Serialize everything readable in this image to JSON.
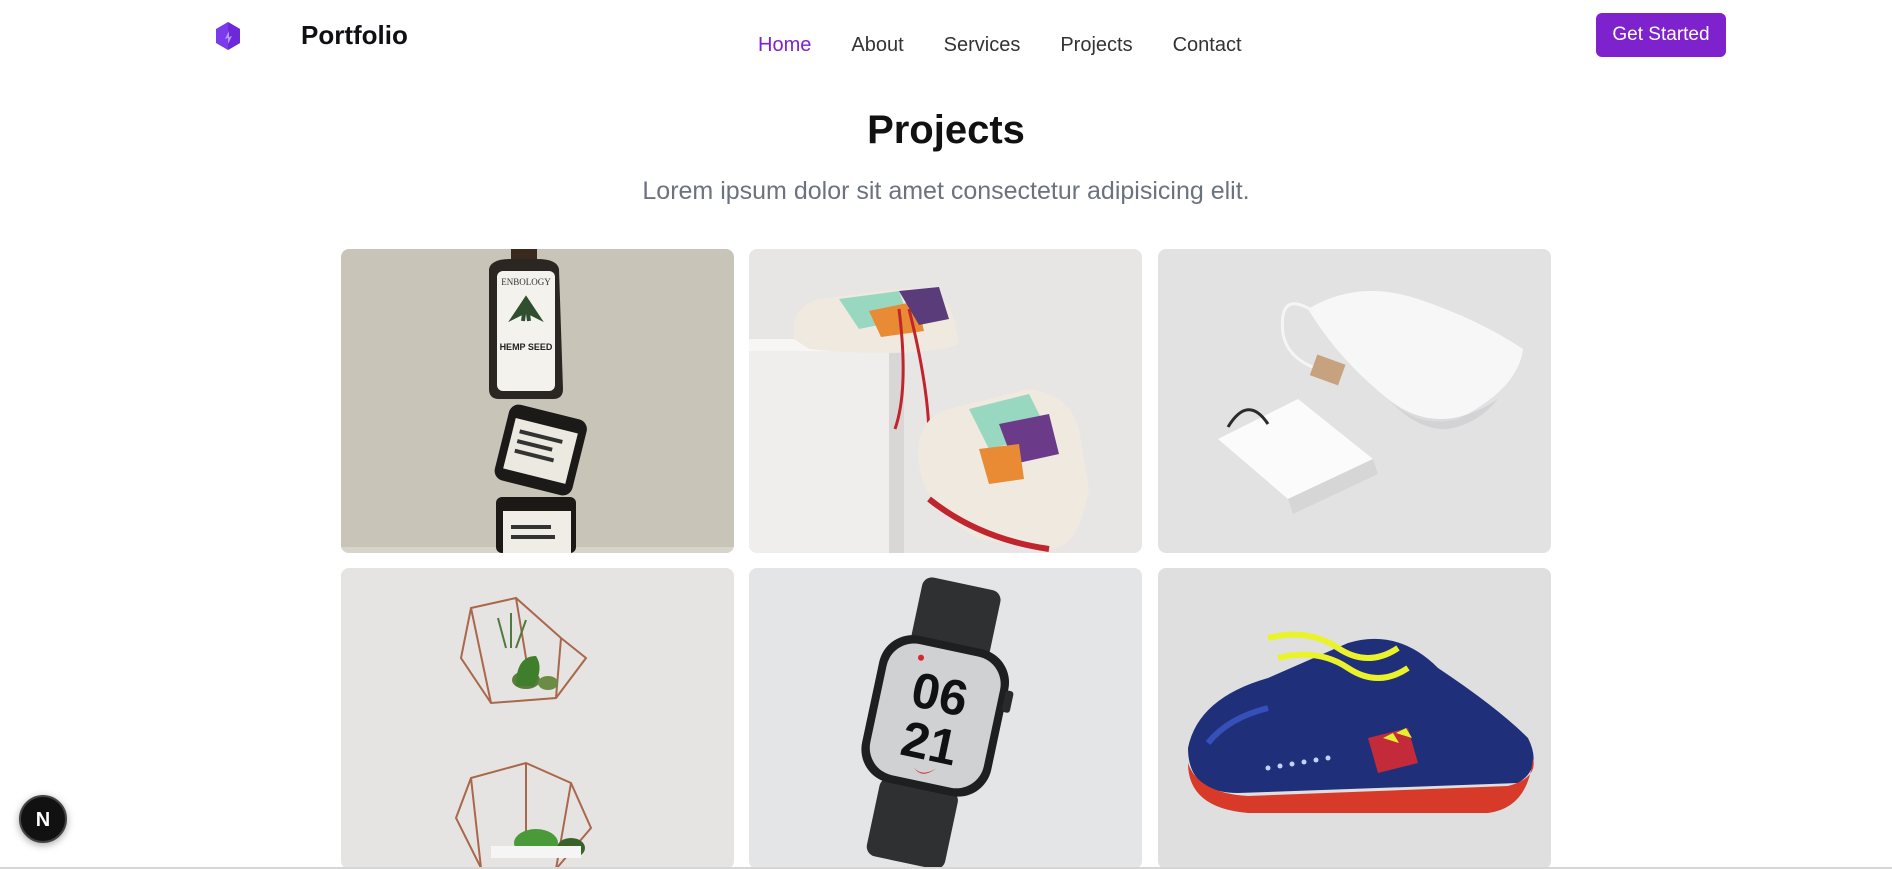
{
  "header": {
    "brand": "Portfolio",
    "nav": [
      "Home",
      "About",
      "Services",
      "Projects",
      "Contact"
    ],
    "active_nav": "Home",
    "cta_label": "Get Started"
  },
  "section": {
    "title": "Projects",
    "subtitle": "Lorem ipsum dolor sit amet consectetur adipisicing elit."
  },
  "projects": [
    {
      "image": "hemp-seed-bottles-photo",
      "label_top": "ENBOLOGY",
      "label_mid": "HEMP SEED"
    },
    {
      "image": "sneakers-on-pedestal-photo"
    },
    {
      "image": "white-bags-mockup-photo"
    },
    {
      "image": "geometric-terrariums-photo"
    },
    {
      "image": "smartwatch-photo",
      "watch_top": "06",
      "watch_bottom": "21"
    },
    {
      "image": "blue-soccer-shoe-photo"
    }
  ],
  "dev_badge": {
    "letter": "N"
  },
  "colors": {
    "accent": "#7e22ce",
    "text": "#111111",
    "muted": "#6b7280"
  }
}
